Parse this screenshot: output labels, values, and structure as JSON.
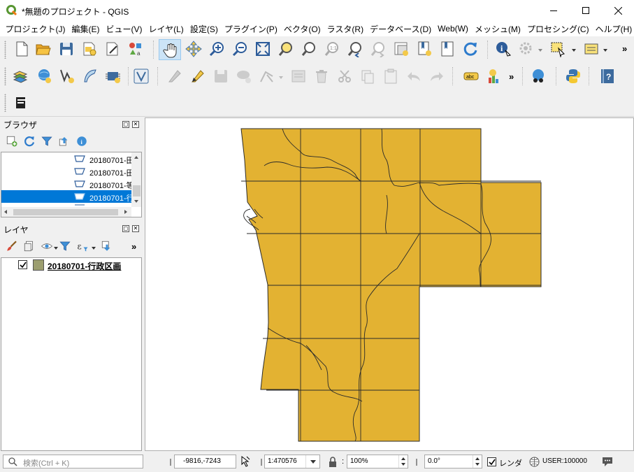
{
  "window": {
    "title": "*無題のプロジェクト - QGIS",
    "minimize_glyph": "—",
    "maximize_glyph": "☐",
    "close_glyph": "✕"
  },
  "menu": [
    "プロジェクト(J)",
    "編集(E)",
    "ビュー(V)",
    "レイヤ(L)",
    "設定(S)",
    "プラグイン(P)",
    "ベクタ(O)",
    "ラスタ(R)",
    "データベース(D)",
    "Web(W)",
    "メッシュ(M)",
    "プロセシング(C)",
    "ヘルプ(H)"
  ],
  "toolbar": {
    "overflow_glyph": "»"
  },
  "browser": {
    "title": "ブラウザ",
    "items": [
      {
        "label": "20180701-田",
        "selected": false
      },
      {
        "label": "20180701-田",
        "selected": false
      },
      {
        "label": "20180701-等",
        "selected": false
      },
      {
        "label": "20180701-行",
        "selected": true
      }
    ]
  },
  "layers": {
    "title": "レイヤ",
    "items": [
      {
        "label": "20180701-行政区画",
        "checked": true,
        "swatch_color": "#9c9e6f"
      }
    ]
  },
  "map": {
    "fill_color": "#e3b232",
    "stroke_color": "#2a2a2a"
  },
  "status": {
    "search_placeholder": "検索(Ctrl + K)",
    "coordinate": "-9816,-7243",
    "scale": "1:470576",
    "magnifier": "100%",
    "rotation": "0.0°",
    "render_label": "レンダ",
    "crs": "USER:100000"
  },
  "colors": {
    "selection": "#0078d7",
    "qgis_green": "#589632"
  }
}
